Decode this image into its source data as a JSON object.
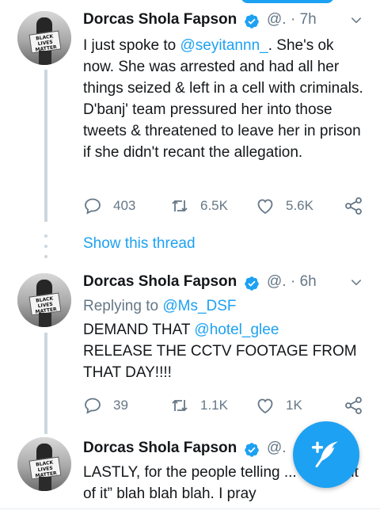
{
  "colors": {
    "accent": "#1da1f2",
    "secondary_text": "#657786",
    "verified": "#1da1f2"
  },
  "show_thread_label": "Show this thread",
  "tweets": [
    {
      "author": "Dorcas Shola Fapson",
      "handle": "@.",
      "time": "· 7h",
      "avatar_sign": "BLACK LIVES MATTER",
      "body_parts": [
        "I just spoke to ",
        "@seyitannn_",
        ". She's ok now. She was arrested and had all her things seized & left in a cell with criminals. D'banj' team pressured her into those tweets & threatened to leave her in prison if she didn't recant the allegation."
      ],
      "replies": "403",
      "retweets": "6.5K",
      "likes": "5.6K"
    },
    {
      "author": "Dorcas Shola Fapson",
      "handle": "@.",
      "time": "· 6h",
      "avatar_sign": "BLACK LIVES MATTER",
      "replying_prefix": "Replying to ",
      "replying_to": "@Ms_DSF",
      "body_line1_prefix": "DEMAND THAT ",
      "body_line1_mention": "@hotel_glee",
      "body_rest": "RELEASE THE CCTV FOOTAGE FROM THAT DAY!!!!",
      "replies": "39",
      "retweets": "1.1K",
      "likes": "1K"
    },
    {
      "author": "Dorcas Shola Fapson",
      "handle": "@.",
      "time": "",
      "avatar_sign": "BLACK LIVES MATTER",
      "body": "LASTLY, for the people telling ... “stay out of it” blah blah blah. I pray"
    }
  ],
  "fab": {
    "icon": "compose-feather-icon"
  }
}
